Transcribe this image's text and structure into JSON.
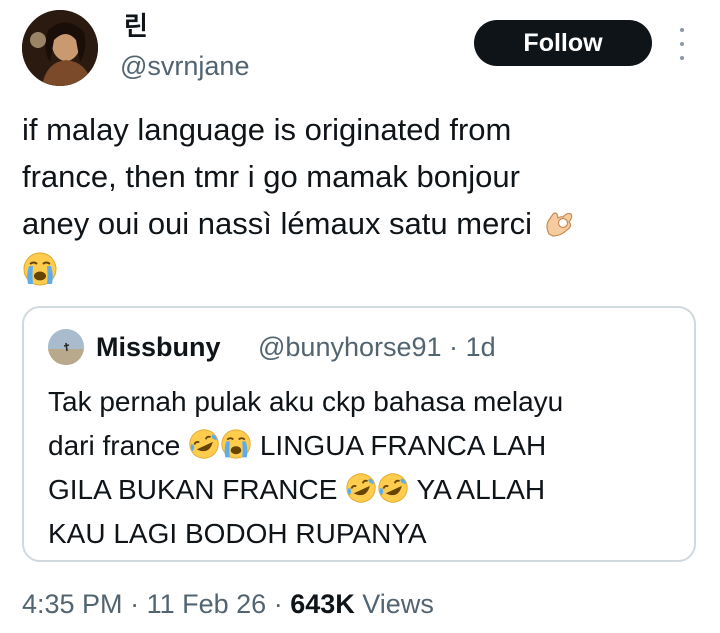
{
  "author": {
    "display_name": "린",
    "handle": "@svrnjane"
  },
  "follow_button": {
    "label": "Follow"
  },
  "more_menu": {
    "icon": "more-vertical-icon"
  },
  "tweet": {
    "lines": [
      "if malay language is originated from",
      "france, then tmr i go mamak bonjour",
      "aney oui oui nassì lémaux satu merci"
    ],
    "emojis": [
      "ok-hand-emoji",
      "loudly-crying-emoji"
    ]
  },
  "quote": {
    "display_name": "Missbuny",
    "handle": "@bunyhorse91",
    "separator": "·",
    "time_ago": "1d",
    "line1": "Tak pernah pulak aku ckp bahasa melayu",
    "line2_prefix": "dari france",
    "line2_suffix": "LINGUA FRANCA LAH",
    "line3_prefix": "GILA BUKAN FRANCE",
    "line3_suffix": "YA ALLAH",
    "line4": "KAU LAGI BODOH RUPANYA",
    "emojis": [
      "rolling-laughing-emoji",
      "loudly-crying-emoji",
      "rolling-laughing-emoji",
      "rolling-laughing-emoji"
    ]
  },
  "footer": {
    "time": "4:35 PM",
    "separator": "·",
    "date": "11 Feb 26",
    "views_count": "643K",
    "views_label": "Views"
  },
  "colors": {
    "text": "#0f1419",
    "secondary": "#536471",
    "border": "#cfd9de",
    "button_bg": "#0f1419"
  }
}
